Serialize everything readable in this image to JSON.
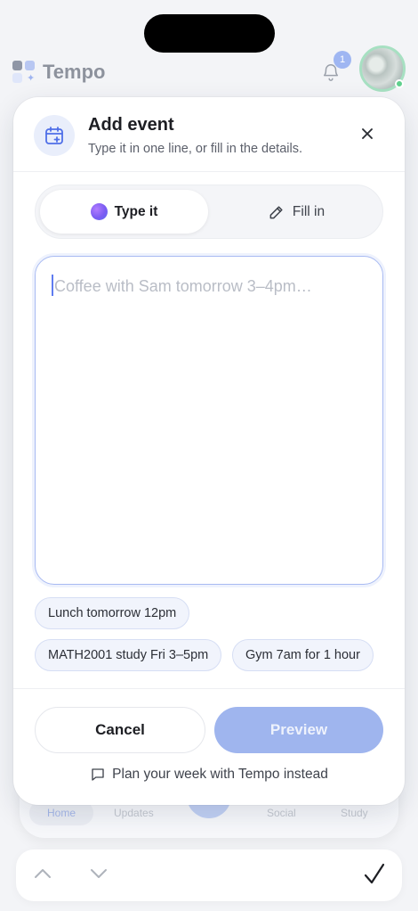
{
  "app": {
    "name": "Tempo",
    "notification_count": "1"
  },
  "tabs": {
    "home": "Home",
    "updates": "Updates",
    "social": "Social",
    "study": "Study"
  },
  "modal": {
    "title": "Add event",
    "subtitle": "Type it in one line, or fill in the details.",
    "mode_tabs": {
      "type_it": "Type it",
      "fill_in": "Fill in",
      "active": "type_it"
    },
    "input": {
      "value": "",
      "placeholder": "Coffee with Sam tomorrow 3–4pm…"
    },
    "suggestions": [
      "Lunch tomorrow 12pm",
      "MATH2001 study Fri 3–5pm",
      "Gym 7am for 1 hour"
    ],
    "cancel_label": "Cancel",
    "preview_label": "Preview",
    "plan_link": "Plan your week with Tempo instead"
  },
  "colors": {
    "accent": "#5f7cf0",
    "preview_disabled": "#9fb5ee",
    "chip_bg": "#f1f4fc"
  }
}
